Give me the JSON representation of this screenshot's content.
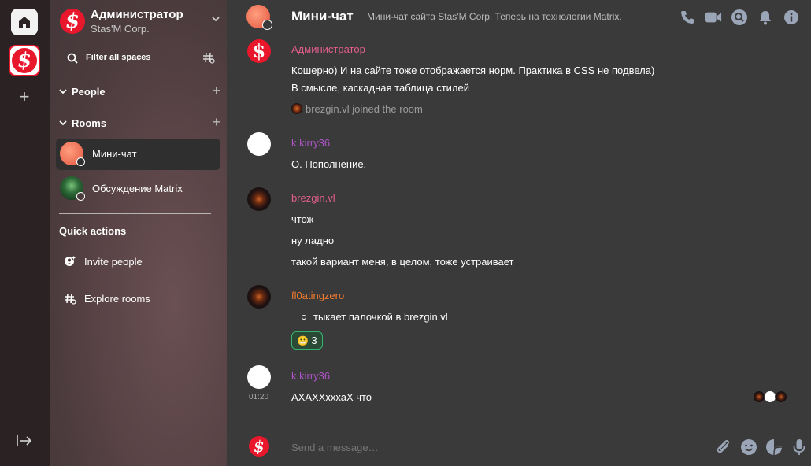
{
  "colors": {
    "accent_red": "#e8172c",
    "sender_admin": "#e35d8d",
    "sender_kirry": "#ad55c7",
    "sender_brezgin": "#e35d8d",
    "sender_fl0ating": "#f17a2e",
    "reaction_green": "#35b36e"
  },
  "space_bar": {
    "home_icon": "home-icon",
    "space_icon": "stasm-logo-icon",
    "add_icon": "plus-icon",
    "expand_icon": "expand-arrow-icon",
    "add_label": "+"
  },
  "room_panel": {
    "user_name": "Администратор",
    "user_org": "Stas'M Corp.",
    "logo_letter": "$",
    "filter_label": "Filter all spaces",
    "sections": {
      "people": "People",
      "rooms": "Rooms"
    },
    "rooms": [
      {
        "name": "Мини-чат",
        "active": true
      },
      {
        "name": "Обсуждение Matrix",
        "active": false
      }
    ],
    "quick_actions_title": "Quick actions",
    "quick_actions": [
      {
        "label": "Invite people",
        "icon": "invite-person-icon"
      },
      {
        "label": "Explore rooms",
        "icon": "explore-hash-icon"
      }
    ]
  },
  "room_header": {
    "name": "Мини-чат",
    "topic": "Мини-чат сайта Stas'M Corp. Теперь на технологии Matrix.",
    "icons": [
      "phone-icon",
      "video-icon",
      "search-icon",
      "bell-icon",
      "info-icon"
    ]
  },
  "timeline": {
    "msg1": {
      "sender": "Администратор",
      "lines": [
        "Кошерно) И на сайте тоже отображается норм. Практика в CSS не подвела)",
        "В смысле, каскадная таблица стилей"
      ]
    },
    "join_event": {
      "text": "brezgin.vl joined the room"
    },
    "msg2": {
      "sender": "k.kirry36",
      "lines": [
        "О. Пополнение."
      ]
    },
    "msg3": {
      "sender": "brezgin.vl",
      "lines": [
        "чтож",
        "ну ладно",
        "такой вариант меня, в целом, тоже устраивает"
      ]
    },
    "msg4": {
      "sender": "fl0atingzero",
      "bullet": "тыкает палочкой в brezgin.vl",
      "reaction": {
        "emoji": "😬",
        "count": "3"
      }
    },
    "msg5": {
      "sender": "k.kirry36",
      "time": "01:20",
      "line": "АХАХХхххаХ что"
    }
  },
  "composer": {
    "placeholder": "Send a message…",
    "icons": [
      "paperclip-icon",
      "emoji-icon",
      "sticker-icon",
      "microphone-icon"
    ]
  }
}
